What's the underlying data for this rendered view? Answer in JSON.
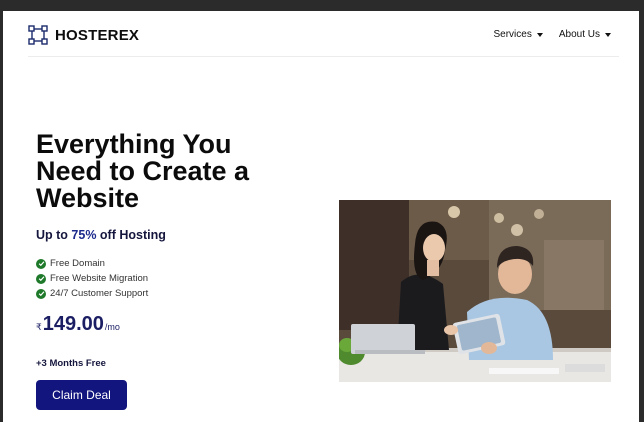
{
  "brand": {
    "name": "HOSTEREX",
    "logo_icon": "frame-corners-icon"
  },
  "nav": {
    "items": [
      {
        "label": "Services"
      },
      {
        "label": "About Us"
      }
    ]
  },
  "hero": {
    "title_lines": [
      "Everything You",
      "Need to Create a",
      "Website"
    ],
    "subhead": {
      "prefix": "Up to ",
      "accent": "75%",
      "suffix": " off Hosting"
    },
    "features": [
      "Free Domain",
      "Free Website Migration",
      "24/7 Customer Support"
    ],
    "price": {
      "currency": "₹",
      "amount": "149.00",
      "period": "/mo"
    },
    "bonus": "+3 Months Free",
    "cta": "Claim Deal",
    "image": {
      "subject": "two-people-with-tablet-photo"
    }
  },
  "colors": {
    "accent": "#13157e",
    "check": "#1e7a2a",
    "price": "#1b1e63"
  }
}
